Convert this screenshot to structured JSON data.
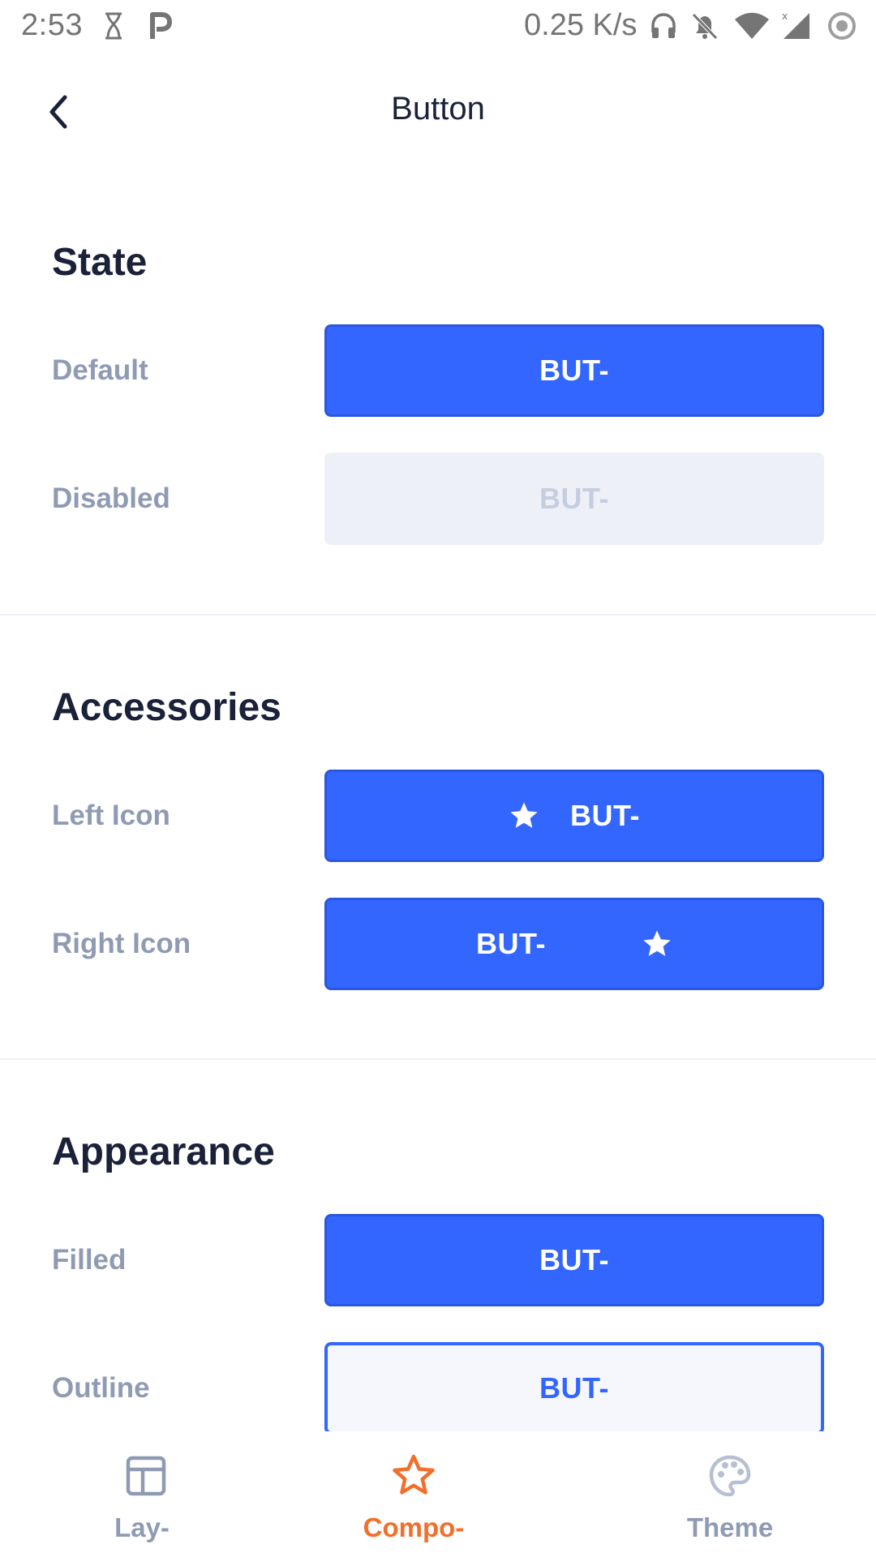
{
  "status_bar": {
    "time": "2:53",
    "net_speed": "0.25 K/s",
    "icons": [
      "hourglass-icon",
      "p-app-icon",
      "headphones-icon",
      "bell-off-icon",
      "wifi-icon",
      "signal-icon",
      "record-icon"
    ]
  },
  "header": {
    "title": "Button",
    "back_icon": "chevron-left-icon"
  },
  "sections": {
    "state": {
      "title": "State",
      "rows": [
        {
          "label": "Default",
          "button": "BUT-"
        },
        {
          "label": "Disabled",
          "button": "BUT-"
        }
      ]
    },
    "accessories": {
      "title": "Accessories",
      "rows": [
        {
          "label": "Left Icon",
          "button": "BUT-",
          "icon": "star-icon"
        },
        {
          "label": "Right Icon",
          "button": "BUT-",
          "icon": "star-icon"
        }
      ]
    },
    "appearance": {
      "title": "Appearance",
      "rows": [
        {
          "label": "Filled",
          "button": "BUT-"
        },
        {
          "label": "Outline",
          "button": "BUT-"
        }
      ]
    }
  },
  "bottom_nav": {
    "items": [
      {
        "label": "Lay-",
        "icon": "layout-icon",
        "active": false
      },
      {
        "label": "Compo-",
        "icon": "star-outline-icon",
        "active": true
      },
      {
        "label": "Theme",
        "icon": "palette-icon",
        "active": false
      }
    ]
  },
  "colors": {
    "primary": "#3366ff",
    "disabled_bg": "#edf1f7",
    "disabled_text": "#c5cee0",
    "label": "#8f9bb3",
    "title": "#1a2138",
    "active_nav": "#f26f2b"
  }
}
